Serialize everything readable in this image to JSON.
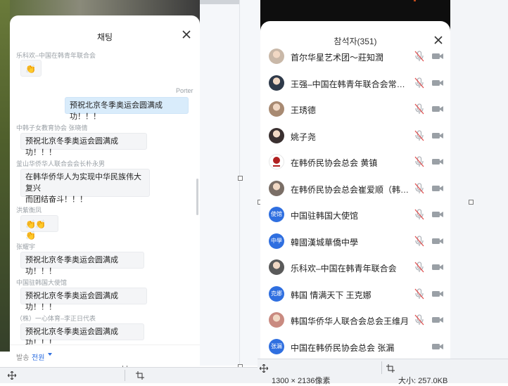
{
  "chat": {
    "title": "채팅",
    "messages": [
      {
        "sender": "乐科欢–中国在韩青年联合会",
        "text": "👏"
      },
      {
        "sender": "Porter",
        "text": "预祝北京冬季奥运会圆满成功！！！"
      },
      {
        "sender": "中韩子女教育协会 张晓倩",
        "text": "预祝北京冬季奥运会圆满成功！！！"
      },
      {
        "sender": "釜山华侨华人联合会会长朴永男",
        "text1": "在韩华侨华人为实现中华民族伟大复兴",
        "text2": "而团结奋斗！！！"
      },
      {
        "sender": "洪紫衡凤",
        "text": "👏👏👏"
      },
      {
        "sender": "张耀宇",
        "text": "预祝北京冬季奥运会圆满成功！！！"
      },
      {
        "sender": "中国驻韩国大使馆",
        "text": "预祝北京冬季奥运会圆满成功！！！"
      },
      {
        "sender": "（株）一心体育–李正日代表",
        "text": "预祝北京冬季奥运会圆满成功！！！"
      }
    ],
    "footer": {
      "label": "발송",
      "target": "전원"
    }
  },
  "participants": {
    "title": "참석자(351)",
    "items": [
      {
        "name": "首尔华星艺术团～莊知潤",
        "avatar": "photo",
        "color": "#c9b8a8",
        "mic_muted": true
      },
      {
        "name": "王强–中国在韩青年联合会常务副会长",
        "avatar": "photo",
        "color": "#2f3a4a",
        "mic_muted": true
      },
      {
        "name": "王琇德",
        "avatar": "photo",
        "color": "#a88a72",
        "mic_muted": true
      },
      {
        "name": "姚子尧",
        "avatar": "photo",
        "color": "#3a3030",
        "mic_muted": true
      },
      {
        "name": "在韩侨民协会总会 黄镇",
        "avatar": "logo",
        "color": "#b02020",
        "mic_muted": true
      },
      {
        "name": "在韩侨民协会总会崔爱顺（韩国华人华侨妇女会长）",
        "avatar": "photo",
        "color": "#7a6e66",
        "mic_muted": true
      },
      {
        "name": "中国驻韩国大使馆",
        "avatar": "使馆",
        "color": "#2f6fe0",
        "mic_muted": true
      },
      {
        "name": "韓國漢城華僑中學",
        "avatar": "中學",
        "color": "#2f6fe0",
        "mic_muted": true
      },
      {
        "name": "乐科欢–中国在韩青年联合会",
        "avatar": "photo",
        "color": "#5a5a5a",
        "mic_muted": true
      },
      {
        "name": "韩国 情满天下 王克娜",
        "avatar": "克娜",
        "color": "#2f6fe0",
        "mic_muted": true
      },
      {
        "name": "韩国华侨华人联合会总会王维月",
        "avatar": "photo",
        "color": "#c98a80",
        "mic_muted": true
      },
      {
        "name": "中国在韩侨民协会总会 张漏",
        "avatar": "张漏",
        "color": "#2f6fe0",
        "mic_muted": false
      }
    ]
  },
  "statusbar": {
    "left_coords": "",
    "size_text": "1300 × 2136像素",
    "file_text": "大小: 257.0KB"
  },
  "colors": {
    "accent": "#2d6ee0",
    "my_bubble": "#d9ecfb",
    "muted_icon": "#b0b4ba"
  }
}
